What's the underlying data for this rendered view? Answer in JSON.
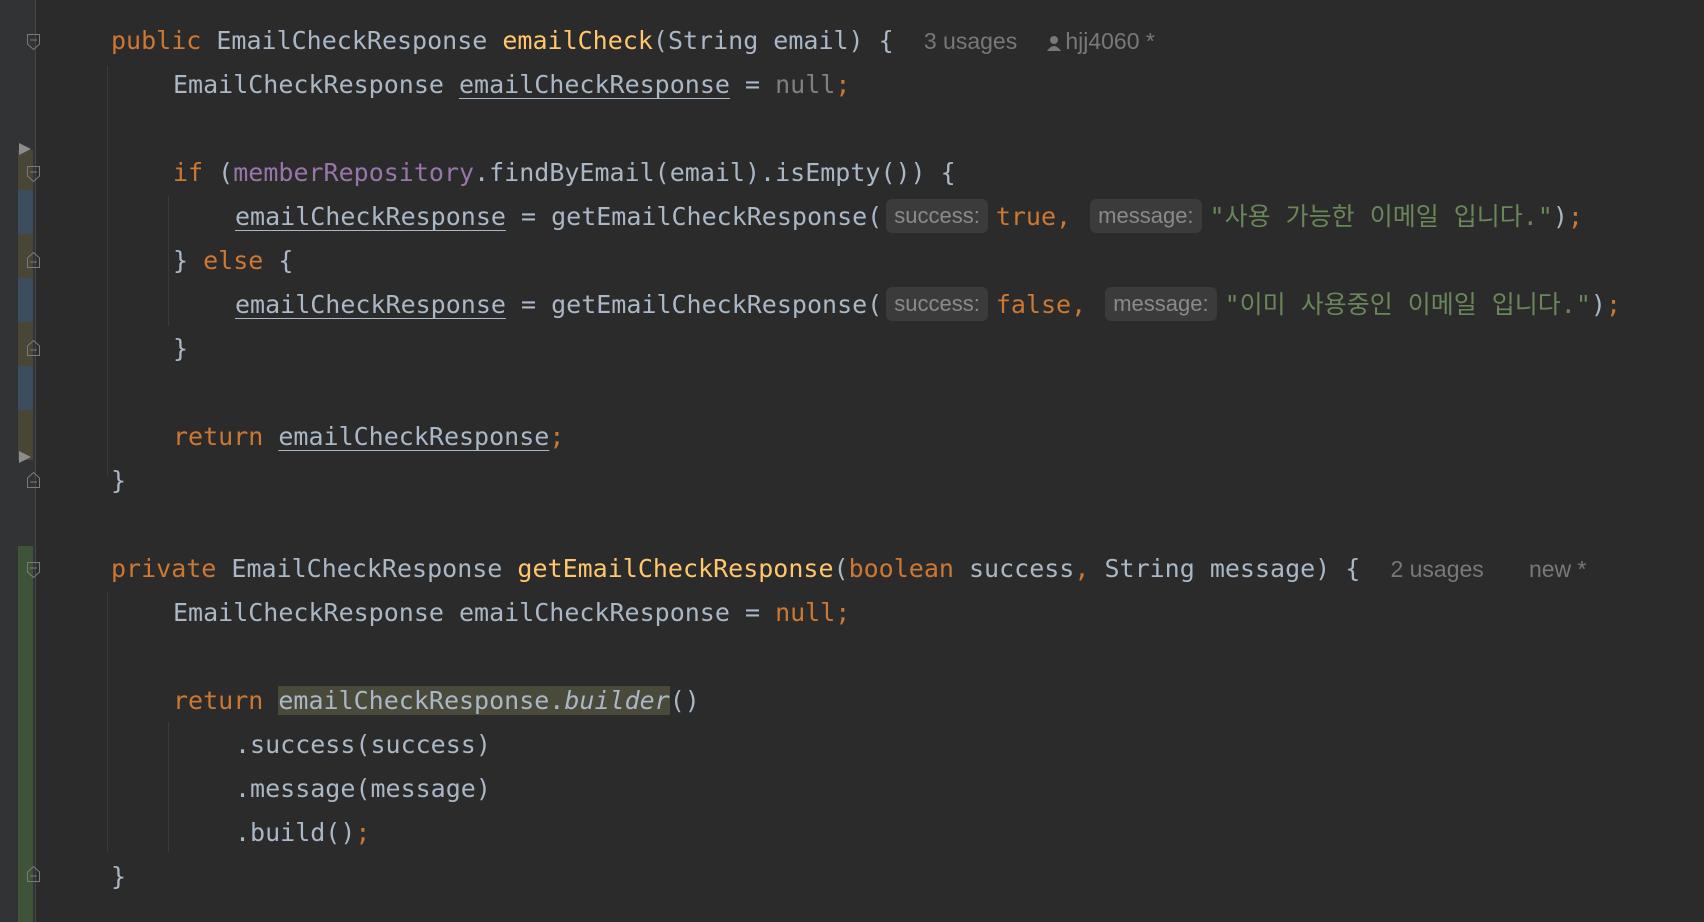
{
  "colors": {
    "background": "#2b2b2b",
    "keyword": "#cc7832",
    "method_decl": "#ffc66d",
    "field": "#9876aa",
    "string": "#6a8759",
    "default_text": "#a9b7c6",
    "hint_text": "#8a8a8a",
    "vcs_added": "#3f5338",
    "vcs_modified": "#3b4d5f"
  },
  "method1": {
    "modifier": "public",
    "return_type": "EmailCheckResponse",
    "name": "emailCheck",
    "params": "(String email)",
    "open_brace": "{",
    "usages": "3 usages",
    "author": "hjj4060 *",
    "var_type": "EmailCheckResponse",
    "var_name": "emailCheckResponse",
    "assign": " = ",
    "null_literal": "null",
    "semicolon": ";",
    "if_kw": "if",
    "if_open": "(",
    "repo_field": "memberRepository",
    "if_rest": ".findByEmail(email).isEmpty()) {",
    "assign_var": "emailCheckResponse",
    "call": "getEmailCheckResponse(",
    "hint_success": "success:",
    "true_val": "true,",
    "hint_message": "message:",
    "msg_available": "\"사용 가능한 이메일 입니다.\"",
    "close_paren": ")",
    "else_close": "}",
    "else_kw": "else",
    "else_open": "{",
    "false_val": "false,",
    "msg_in_use": "\"이미 사용중인 이메일 입니다.\"",
    "block_close": "}",
    "return_kw": "return",
    "return_var": "emailCheckResponse",
    "method_close": "}"
  },
  "method2": {
    "modifier": "private",
    "return_type": "EmailCheckResponse",
    "name": "getEmailCheckResponse",
    "param_open": "(",
    "param1_type": "boolean",
    "param1_name": "success",
    "comma": ",",
    "param2": "String message) {",
    "usages": "2 usages",
    "author": "new *",
    "var_decl": "EmailCheckResponse emailCheckResponse = ",
    "null_literal": "null",
    "semicolon": ";",
    "return_kw": "return",
    "builder_target": "emailCheckResponse.",
    "builder_method": "builder",
    "builder_parens": "()",
    "chain_success": ".success(success)",
    "chain_message": ".message(message)",
    "chain_build": ".build()",
    "method_close": "}"
  },
  "icons": {
    "fold_marker": "fold-icon",
    "run_marker": "run-triangle-icon",
    "author_marker": "user-icon"
  }
}
